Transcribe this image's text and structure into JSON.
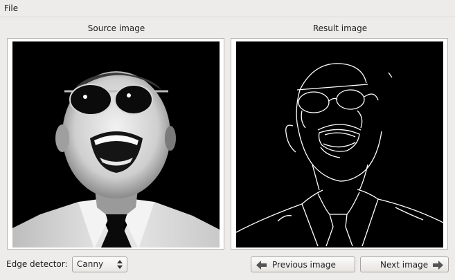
{
  "menubar": {
    "file": "File"
  },
  "source": {
    "caption": "Source image"
  },
  "result": {
    "caption": "Result image"
  },
  "detector": {
    "label": "Edge detector:",
    "value": "Canny"
  },
  "nav": {
    "previous": "Previous image",
    "next": "Next image"
  },
  "icons": {
    "previous": "arrow-left-icon",
    "next": "arrow-right-icon",
    "combo": "spin-arrows-icon"
  },
  "colors": {
    "window_bg": "#edeceb",
    "image_bg": "#000000",
    "edge_stroke": "#ffffff"
  }
}
